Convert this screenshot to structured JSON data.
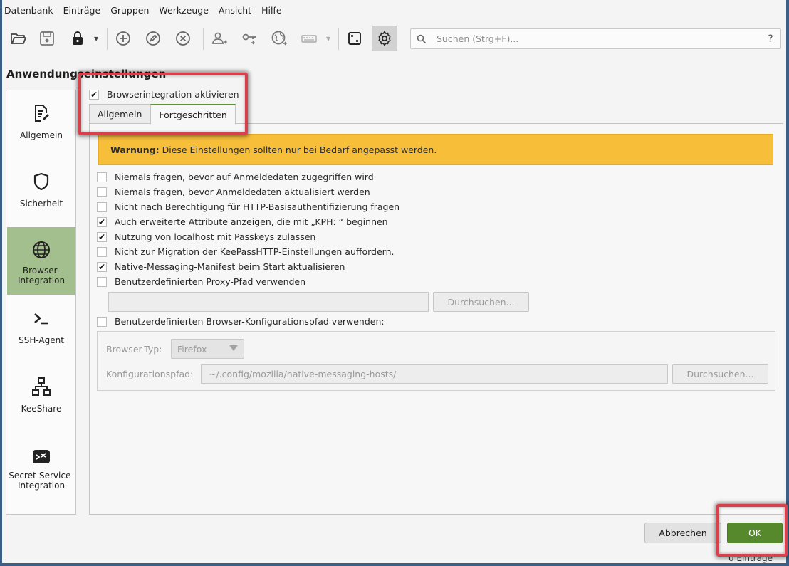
{
  "menu": [
    "Datenbank",
    "Einträge",
    "Gruppen",
    "Werkzeuge",
    "Ansicht",
    "Hilfe"
  ],
  "toolbar": {
    "icons": [
      "open-folder-icon",
      "save-icon",
      "lock-icon",
      "add-entry-icon",
      "edit-entry-icon",
      "delete-entry-icon",
      "user-copy-icon",
      "key-copy-icon",
      "url-open-icon",
      "keyboard-autotype-icon",
      "dice-generator-icon",
      "gear-settings-icon"
    ],
    "search_placeholder": "Suchen (Strg+F)...",
    "help": "?"
  },
  "page_title": "Anwendungseinstellungen",
  "sidebar": {
    "items": [
      {
        "label": "Allgemein",
        "icon": "document-edit-icon"
      },
      {
        "label": "Sicherheit",
        "icon": "shield-icon"
      },
      {
        "label": "Browser-\nIntegration",
        "label_line1": "Browser-",
        "label_line2": "Integration",
        "icon": "globe-icon"
      },
      {
        "label": "SSH-Agent",
        "icon": "terminal-icon"
      },
      {
        "label": "KeeShare",
        "icon": "network-icon"
      },
      {
        "label_line1": "Secret-Service-",
        "label_line2": "Integration",
        "icon": "secret-service-icon"
      }
    ],
    "selected_index": 2
  },
  "browser_integration": {
    "enable_label": "Browserintegration aktivieren",
    "enable_checked": true,
    "tabs": [
      "Allgemein",
      "Fortgeschritten"
    ],
    "active_tab": 1
  },
  "advanced": {
    "warning_bold": "Warnung:",
    "warning_text": "Diese Einstellungen sollten nur bei Bedarf angepasst werden.",
    "options": [
      {
        "label": "Niemals fragen, bevor auf Anmeldedaten zugegriffen wird",
        "checked": false
      },
      {
        "label": "Niemals fragen, bevor Anmeldedaten aktualisiert werden",
        "checked": false
      },
      {
        "label": "Nicht nach Berechtigung für HTTP-Basisauthentifizierung fragen",
        "checked": false
      },
      {
        "label": "Auch erweiterte Attribute anzeigen, die mit „KPH: “ beginnen",
        "checked": true
      },
      {
        "label": "Nutzung von localhost mit Passkeys zulassen",
        "checked": true
      },
      {
        "label": "Nicht zur Migration der KeePassHTTP-Einstellungen auffordern.",
        "checked": false
      },
      {
        "label": "Native-Messaging-Manifest beim Start aktualisieren",
        "checked": true
      },
      {
        "label": "Benutzerdefinierten Proxy-Pfad verwenden",
        "checked": false
      }
    ],
    "proxy_path_value": "",
    "browse_label": "Durchsuchen...",
    "custom_config_label": "Benutzerdefinierten Browser-Konfigurationspfad verwenden:",
    "custom_config_checked": false,
    "browser_type_label": "Browser-Typ:",
    "browser_type_value": "Firefox",
    "config_path_label": "Konfigurationspfad:",
    "config_path_value": "~/.config/mozilla/native-messaging-hosts/",
    "browse_label_2": "Durchsuchen..."
  },
  "footer": {
    "cancel": "Abbrechen",
    "ok": "OK",
    "status": "0 Einträge"
  },
  "colors": {
    "accent_green": "#56892c",
    "nav_selected": "#a3bf8d",
    "warning": "#f7be3a",
    "highlight": "#d8414b"
  }
}
